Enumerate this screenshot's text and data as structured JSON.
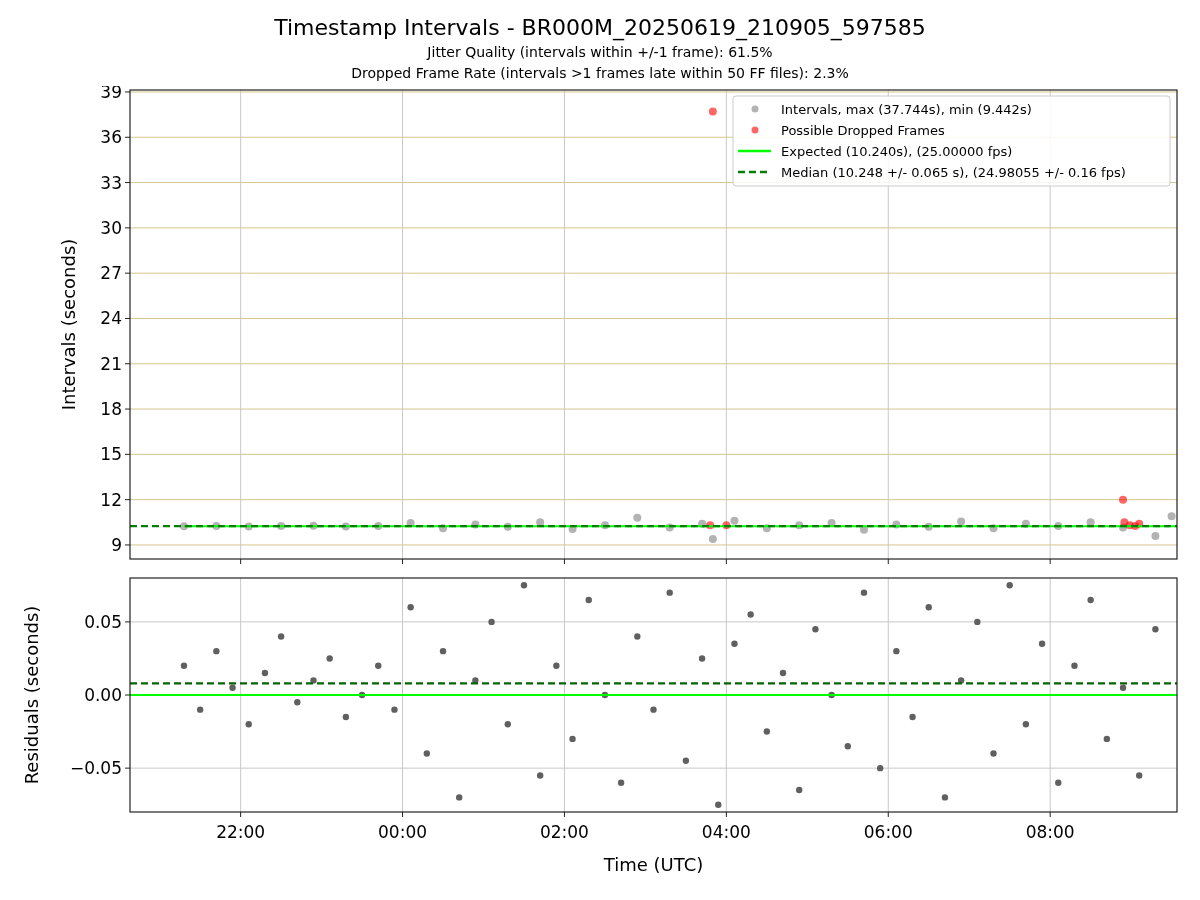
{
  "figure": {
    "title": "Timestamp Intervals - BR000M_20250619_210905_597585",
    "subtitles": [
      "Jitter Quality (intervals within +/-1 frame): 61.5%",
      "Dropped Frame Rate (intervals >1 frames late within 50 FF files): 2.3%"
    ]
  },
  "intervals_panel": {
    "chart_data": {
      "type": "scatter",
      "ylabel": "Intervals (seconds)",
      "xlim": [
        "2025-06-19T20:38",
        "2025-06-20T09:34"
      ],
      "ylim": [
        8.07,
        39.13
      ],
      "grid": true,
      "legend": true,
      "yticks": [
        {
          "value": 9,
          "label": "9"
        },
        {
          "value": 12,
          "label": "12"
        },
        {
          "value": 15,
          "label": "15"
        },
        {
          "value": 18,
          "label": "18"
        },
        {
          "value": 21,
          "label": "21"
        },
        {
          "value": 24,
          "label": "24"
        },
        {
          "value": 27,
          "label": "27"
        },
        {
          "value": 30,
          "label": "30"
        },
        {
          "value": 33,
          "label": "33"
        },
        {
          "value": 36,
          "label": "36"
        },
        {
          "value": 39,
          "label": "39"
        }
      ],
      "series": [
        {
          "name": "Intervals, max (37.744s), min (9.442s)",
          "color": "#808080",
          "type": "scatter",
          "x": [
            "2025-06-19T21:18",
            "2025-06-19T21:42",
            "2025-06-19T22:06",
            "2025-06-19T22:30",
            "2025-06-19T22:54",
            "2025-06-19T23:18",
            "2025-06-19T23:42",
            "2025-06-20T00:06",
            "2025-06-20T00:30",
            "2025-06-20T00:54",
            "2025-06-20T01:18",
            "2025-06-20T01:42",
            "2025-06-20T02:06",
            "2025-06-20T02:30",
            "2025-06-20T02:54",
            "2025-06-20T03:18",
            "2025-06-20T03:42",
            "2025-06-20T03:50",
            "2025-06-20T04:06",
            "2025-06-20T04:30",
            "2025-06-20T04:54",
            "2025-06-20T05:18",
            "2025-06-20T05:42",
            "2025-06-20T06:06",
            "2025-06-20T06:30",
            "2025-06-20T06:54",
            "2025-06-20T07:18",
            "2025-06-20T07:42",
            "2025-06-20T08:06",
            "2025-06-20T08:30",
            "2025-06-20T08:54",
            "2025-06-20T09:18",
            "2025-06-20T09:30"
          ],
          "values": [
            10.24,
            10.26,
            10.22,
            10.25,
            10.27,
            10.23,
            10.26,
            10.45,
            10.1,
            10.35,
            10.2,
            10.5,
            10.05,
            10.3,
            10.8,
            10.15,
            10.4,
            9.4,
            10.6,
            10.1,
            10.3,
            10.45,
            10.0,
            10.35,
            10.2,
            10.55,
            10.1,
            10.4,
            10.25,
            10.5,
            10.15,
            9.6,
            10.9
          ]
        },
        {
          "name": "Possible Dropped Frames",
          "color": "#ff0000",
          "type": "scatter",
          "x": [
            "2025-06-20T03:50",
            "2025-06-20T03:48",
            "2025-06-20T04:00",
            "2025-06-20T08:54",
            "2025-06-20T08:55",
            "2025-06-20T08:59",
            "2025-06-20T09:03",
            "2025-06-20T09:06"
          ],
          "values": [
            37.7,
            10.3,
            10.3,
            12.0,
            10.5,
            10.3,
            10.25,
            10.4
          ]
        },
        {
          "name": "Expected (10.240s), (25.00000 fps)",
          "color": "#00ff00",
          "type": "line",
          "line_style": "solid",
          "x": [
            "2025-06-19T21:18",
            "2025-06-20T09:34"
          ],
          "values": [
            10.24,
            10.24
          ]
        },
        {
          "name": "Median (10.248 +/- 0.065 s), (24.98055 +/- 0.16 fps)",
          "color": "#008000",
          "type": "line",
          "line_style": "dashed",
          "x": [
            "2025-06-19T20:38",
            "2025-06-20T09:34"
          ],
          "values": [
            10.25,
            10.25
          ]
        }
      ]
    }
  },
  "residuals_panel": {
    "chart_data": {
      "type": "scatter",
      "xlabel": "Time (UTC)",
      "ylabel": "Residuals (seconds)",
      "xlim": [
        "2025-06-19T20:38",
        "2025-06-20T09:34"
      ],
      "ylim": [
        -0.08,
        0.08
      ],
      "grid": true,
      "xticks": [
        {
          "value": "2025-06-19T22:00",
          "label": "22:00"
        },
        {
          "value": "2025-06-20T00:00",
          "label": "00:00"
        },
        {
          "value": "2025-06-20T02:00",
          "label": "02:00"
        },
        {
          "value": "2025-06-20T04:00",
          "label": "04:00"
        },
        {
          "value": "2025-06-20T06:00",
          "label": "06:00"
        },
        {
          "value": "2025-06-20T08:00",
          "label": "08:00"
        }
      ],
      "yticks": [
        {
          "value": -0.05,
          "label": "−0.05"
        },
        {
          "value": 0,
          "label": "0.00"
        },
        {
          "value": 0.05,
          "label": "0.05"
        }
      ],
      "series": [
        {
          "color": "#606060",
          "type": "scatter",
          "x": [
            "2025-06-19T21:18",
            "2025-06-19T21:30",
            "2025-06-19T21:42",
            "2025-06-19T21:54",
            "2025-06-19T22:06",
            "2025-06-19T22:18",
            "2025-06-19T22:30",
            "2025-06-19T22:42",
            "2025-06-19T22:54",
            "2025-06-19T23:06",
            "2025-06-19T23:18",
            "2025-06-19T23:30",
            "2025-06-19T23:42",
            "2025-06-19T23:54",
            "2025-06-20T00:06",
            "2025-06-20T00:18",
            "2025-06-20T00:30",
            "2025-06-20T00:42",
            "2025-06-20T00:54",
            "2025-06-20T01:06",
            "2025-06-20T01:18",
            "2025-06-20T01:30",
            "2025-06-20T01:42",
            "2025-06-20T01:54",
            "2025-06-20T02:06",
            "2025-06-20T02:18",
            "2025-06-20T02:30",
            "2025-06-20T02:42",
            "2025-06-20T02:54",
            "2025-06-20T03:06",
            "2025-06-20T03:18",
            "2025-06-20T03:30",
            "2025-06-20T03:42",
            "2025-06-20T03:54",
            "2025-06-20T04:06",
            "2025-06-20T04:18",
            "2025-06-20T04:30",
            "2025-06-20T04:42",
            "2025-06-20T04:54",
            "2025-06-20T05:06",
            "2025-06-20T05:18",
            "2025-06-20T05:30",
            "2025-06-20T05:42",
            "2025-06-20T05:54",
            "2025-06-20T06:06",
            "2025-06-20T06:18",
            "2025-06-20T06:30",
            "2025-06-20T06:42",
            "2025-06-20T06:54",
            "2025-06-20T07:06",
            "2025-06-20T07:18",
            "2025-06-20T07:30",
            "2025-06-20T07:42",
            "2025-06-20T07:54",
            "2025-06-20T08:06",
            "2025-06-20T08:18",
            "2025-06-20T08:30",
            "2025-06-20T08:42",
            "2025-06-20T08:54",
            "2025-06-20T09:06",
            "2025-06-20T09:18"
          ],
          "values": [
            0.02,
            -0.01,
            0.03,
            0.005,
            -0.02,
            0.015,
            0.04,
            -0.005,
            0.01,
            0.025,
            -0.015,
            0.0,
            0.02,
            -0.01,
            0.06,
            -0.04,
            0.03,
            -0.07,
            0.01,
            0.05,
            -0.02,
            0.075,
            -0.055,
            0.02,
            -0.03,
            0.065,
            0.0,
            -0.06,
            0.04,
            -0.01,
            0.07,
            -0.045,
            0.025,
            -0.075,
            0.035,
            0.055,
            -0.025,
            0.015,
            -0.065,
            0.045,
            0.0,
            -0.035,
            0.07,
            -0.05,
            0.03,
            -0.015,
            0.06,
            -0.07,
            0.01,
            0.05,
            -0.04,
            0.075,
            -0.02,
            0.035,
            -0.06,
            0.02,
            0.065,
            -0.03,
            0.005,
            -0.055,
            0.045
          ]
        },
        {
          "color": "#00ff00",
          "type": "line",
          "line_style": "solid",
          "x": [
            "2025-06-19T20:38",
            "2025-06-20T09:34"
          ],
          "values": [
            0,
            0
          ]
        },
        {
          "color": "#006400",
          "type": "line",
          "line_style": "dashed",
          "x": [
            "2025-06-19T20:38",
            "2025-06-20T09:34"
          ],
          "values": [
            0.008,
            0.008
          ]
        }
      ]
    }
  }
}
